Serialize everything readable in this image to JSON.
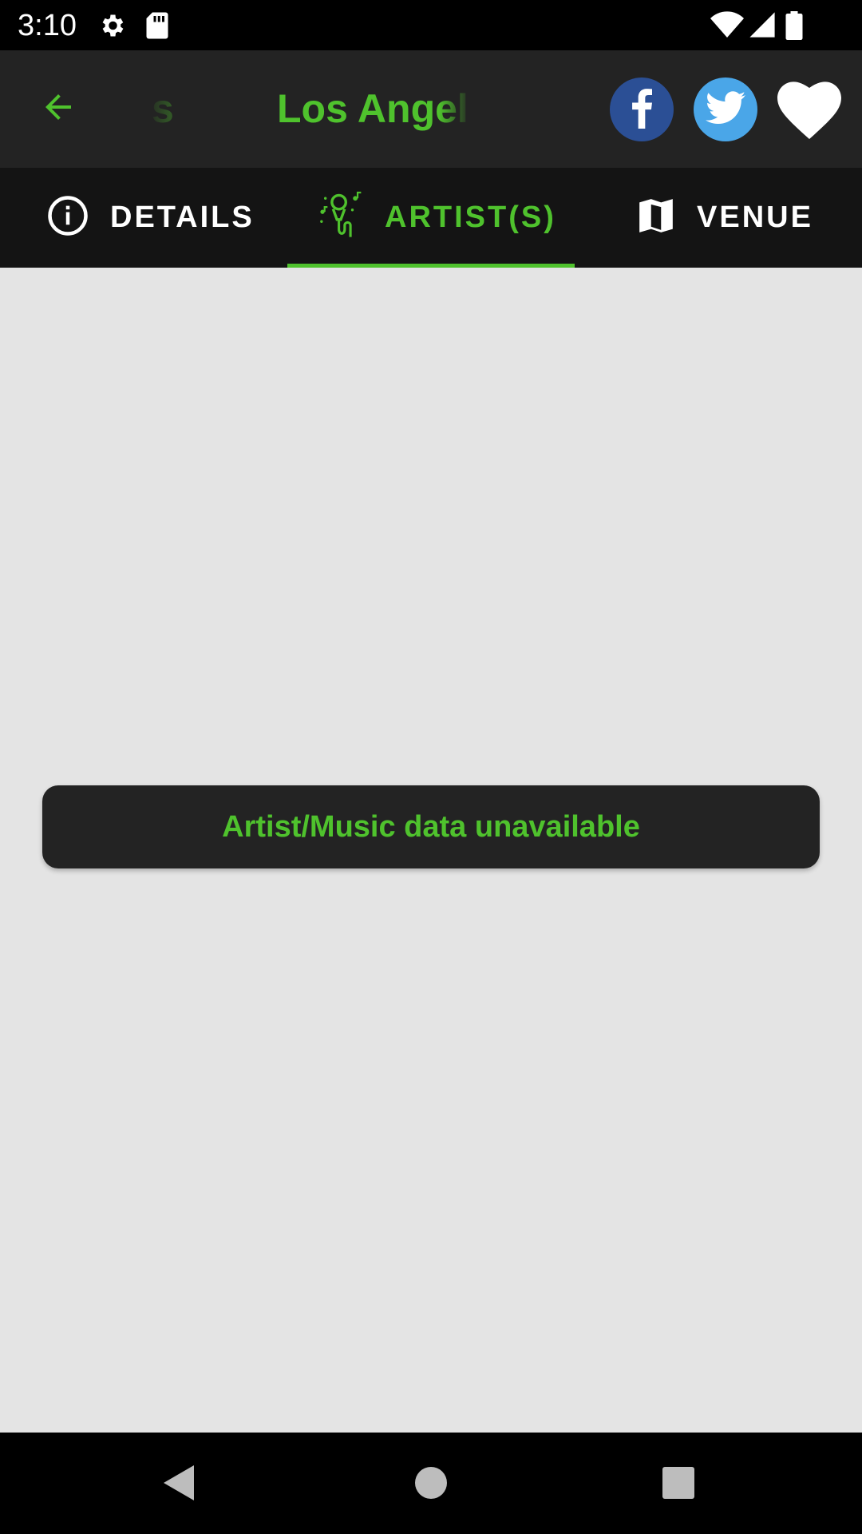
{
  "status_bar": {
    "time": "3:10",
    "left_icons": [
      "gear-icon",
      "sd-card-icon"
    ],
    "right_icons": [
      "wifi-icon",
      "cell-signal-icon",
      "battery-icon"
    ]
  },
  "app_bar": {
    "title_ghost": "s",
    "title": "Los Angel",
    "back_icon": "arrow-back-icon",
    "actions": [
      "facebook-icon",
      "twitter-icon",
      "heart-icon"
    ]
  },
  "tabs": [
    {
      "label": "DETAILS",
      "icon": "info-icon",
      "active": false
    },
    {
      "label": "ARTIST(S)",
      "icon": "microphone-icon",
      "active": true
    },
    {
      "label": "VENUE",
      "icon": "map-icon",
      "active": false
    }
  ],
  "content": {
    "message": "Artist/Music data unavailable"
  },
  "colors": {
    "accent": "#4fc22d",
    "app_bar": "#232323",
    "tab_bar": "#141414",
    "background": "#e4e4e4",
    "facebook": "#2b4f95",
    "twitter": "#4aa6e8"
  },
  "nav_bar": [
    "back-triangle-icon",
    "home-circle-icon",
    "recents-square-icon"
  ]
}
